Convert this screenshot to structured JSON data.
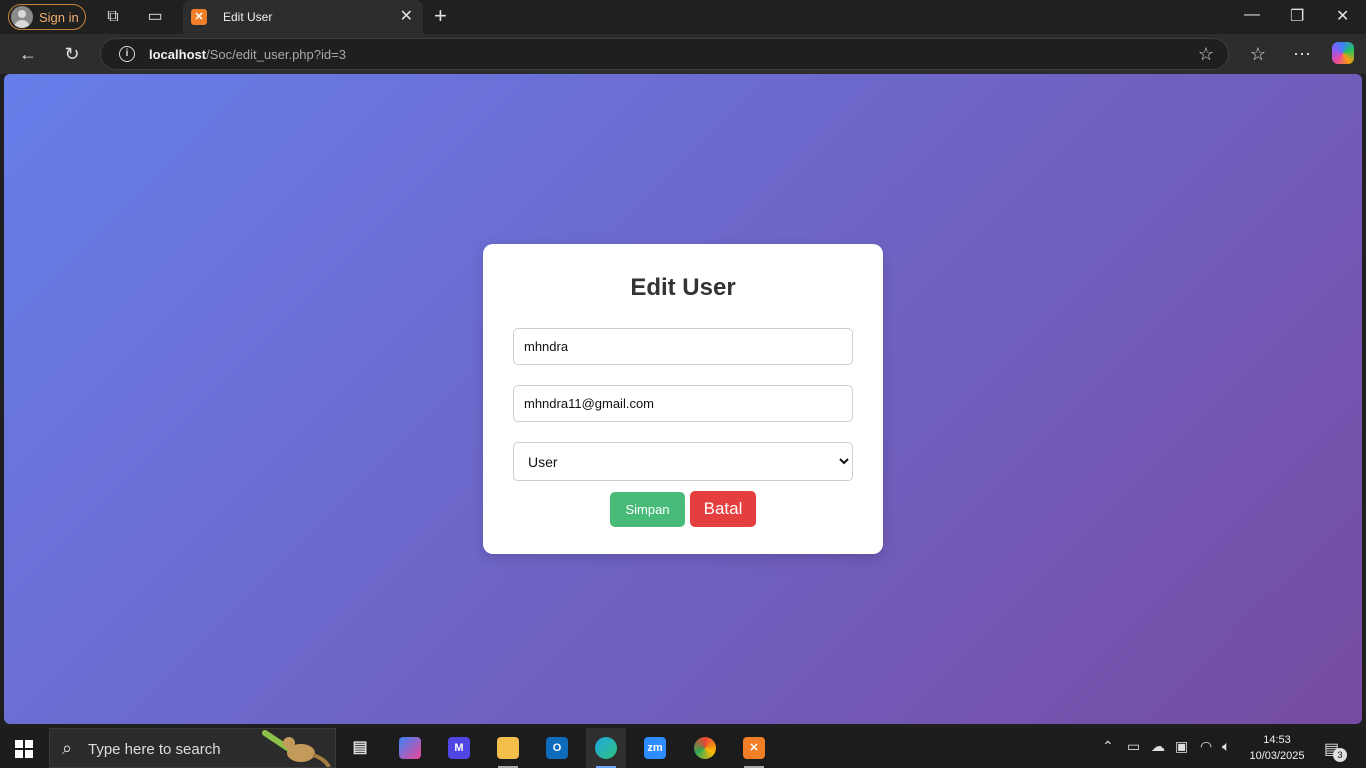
{
  "browser": {
    "signin_label": "Sign in",
    "tab_title": "Edit User",
    "url_host": "localhost",
    "url_path": "/Soc/edit_user.php?id=3"
  },
  "form": {
    "title": "Edit User",
    "username_value": "mhndra",
    "email_value": "mhndra11@gmail.com",
    "role_selected": "User",
    "save_label": "Simpan",
    "cancel_label": "Batal"
  },
  "taskbar": {
    "search_placeholder": "Type here to search",
    "time": "14:53",
    "date": "10/03/2025",
    "notification_count": "3"
  },
  "colors": {
    "gradient_start": "#667eea",
    "gradient_end": "#764ba2",
    "save_button": "#48bb78",
    "cancel_button": "#e53e3e"
  }
}
